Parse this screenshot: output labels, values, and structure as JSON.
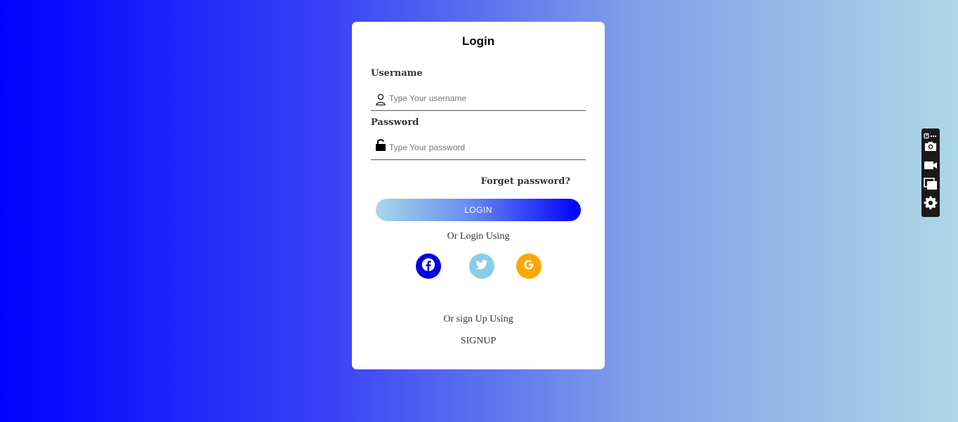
{
  "login_form": {
    "title": "Login",
    "username_label": "Username",
    "username_placeholder": "Type Your username",
    "password_label": "Password",
    "password_placeholder": "Type Your password",
    "forgot_password": "Forget password?",
    "login_button": "LOGIN",
    "or_login_text": "Or Login Using",
    "social": [
      {
        "name": "facebook",
        "icon": "facebook-icon",
        "color": "#0000e6"
      },
      {
        "name": "twitter",
        "icon": "twitter-icon",
        "color": "#87ceeb"
      },
      {
        "name": "google",
        "icon": "google-icon",
        "color": "#ffa500"
      }
    ],
    "or_signup_text": "Or sign Up Using",
    "signup_link": "SIGNUP"
  },
  "colors": {
    "background_gradient": [
      "#0000ff",
      "#add8e6"
    ],
    "card": "#ffffff",
    "button_gradient": [
      "#a8d8e8",
      "#0000ff"
    ]
  },
  "capture_toolbar": {
    "items": [
      "camera-icon",
      "video-icon",
      "window-icon",
      "gear-icon"
    ]
  }
}
